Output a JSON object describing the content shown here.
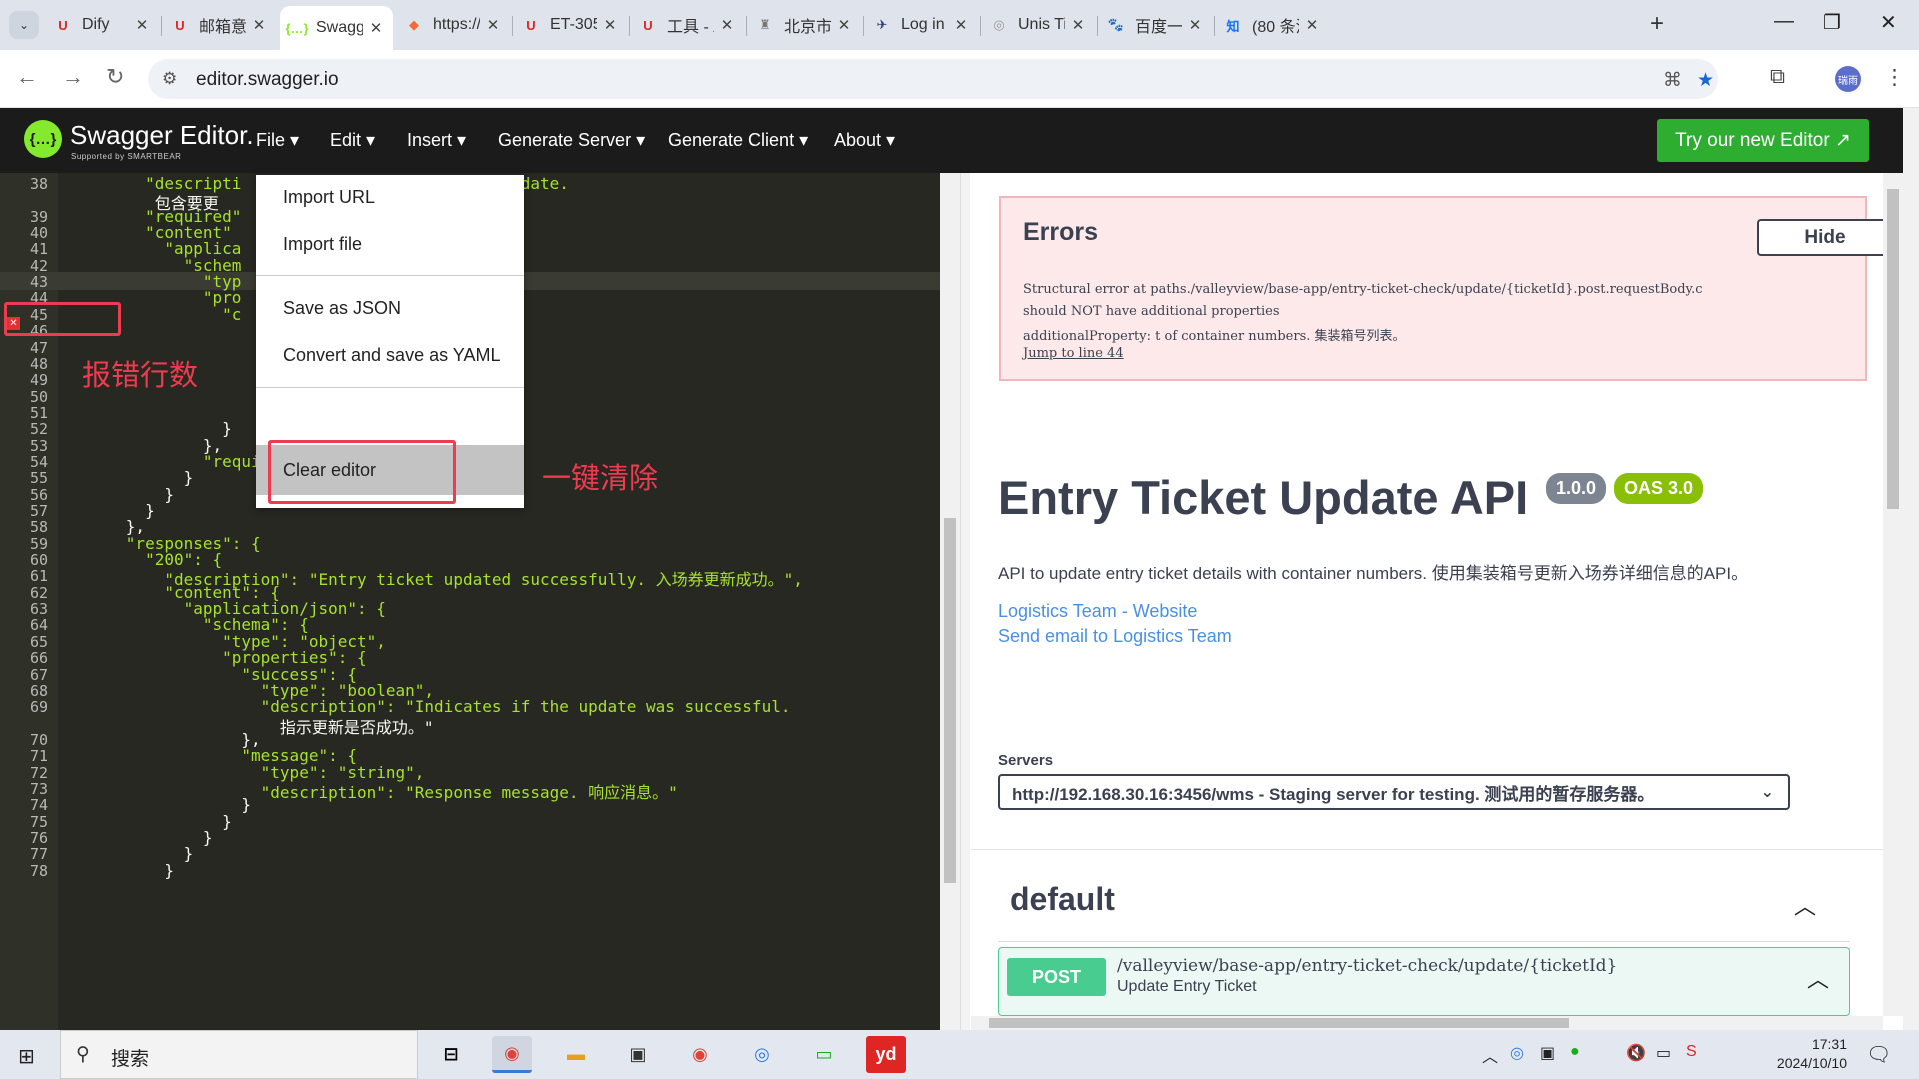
{
  "browser": {
    "tabs": [
      {
        "title": "Dify",
        "fav": "U",
        "fav_color": "#e02525"
      },
      {
        "title": "邮箱意",
        "fav": "U",
        "fav_color": "#e02525"
      },
      {
        "title": "Swagge",
        "fav": "{…}",
        "fav_color": "#85ea2d",
        "active": true
      },
      {
        "title": "https://",
        "fav": "◆",
        "fav_color": "#f46a35"
      },
      {
        "title": "ET-305",
        "fav": "U",
        "fav_color": "#e02525"
      },
      {
        "title": "工具 - A",
        "fav": "U",
        "fav_color": "#e02525"
      },
      {
        "title": "北京市",
        "fav": "♜",
        "fav_color": "#777777"
      },
      {
        "title": "Log in -",
        "fav": "✈",
        "fav_color": "#283b7e"
      },
      {
        "title": "Unis Tic",
        "fav": "◎",
        "fav_color": "#999999"
      },
      {
        "title": "百度一T",
        "fav": "🐾",
        "fav_color": "#2932e1"
      },
      {
        "title": "(80 条消",
        "fav": "知",
        "fav_color": "#1772f6"
      }
    ],
    "url": "editor.swagger.io",
    "avatar_text": "瑞雨"
  },
  "swagger_header": {
    "logo_title": "Swagger Editor.",
    "logo_sub": "Supported by SMARTBEAR",
    "menus": [
      "File ▾",
      "Edit ▾",
      "Insert ▾",
      "Generate Server ▾",
      "Generate Client ▾",
      "About ▾"
    ],
    "try_button": "Try our new Editor ↗"
  },
  "editor": {
    "lines": [
      {
        "n": "38",
        "code": "        \"descripti  \"  ...  ainer numbers to update.",
        "hl": "k"
      },
      {
        "n": "",
        "code": "         包含要更"
      },
      {
        "n": "39",
        "code": "        \"required\""
      },
      {
        "n": "40",
        "code": "        \"content\""
      },
      {
        "n": "41",
        "code": "          \"applica"
      },
      {
        "n": "42",
        "code": "            \"schem"
      },
      {
        "n": "43",
        "code": "              \"typ"
      },
      {
        "n": "44",
        "code": "              \"pro"
      },
      {
        "n": "45",
        "code": "                \"c"
      },
      {
        "n": "46",
        "code": ""
      },
      {
        "n": "47",
        "code": "                                   装箱号列表。\","
      },
      {
        "n": "48",
        "code": ""
      },
      {
        "n": "49",
        "code": ""
      },
      {
        "n": "50",
        "code": ""
      },
      {
        "n": "51",
        "code": ""
      },
      {
        "n": "52",
        "code": "                }"
      },
      {
        "n": "53",
        "code": "              },"
      },
      {
        "n": "54",
        "code": "              \"required\": [\"containerNOs\"]"
      },
      {
        "n": "55",
        "code": "            }"
      },
      {
        "n": "56",
        "code": "          }"
      },
      {
        "n": "57",
        "code": "        }"
      },
      {
        "n": "58",
        "code": "      },"
      },
      {
        "n": "59",
        "code": "      \"responses\": {"
      },
      {
        "n": "60",
        "code": "        \"200\": {"
      },
      {
        "n": "61",
        "code": "          \"description\": \"Entry ticket updated successfully. 入场券更新成功。\","
      },
      {
        "n": "62",
        "code": "          \"content\": {"
      },
      {
        "n": "63",
        "code": "            \"application/json\": {"
      },
      {
        "n": "64",
        "code": "              \"schema\": {"
      },
      {
        "n": "65",
        "code": "                \"type\": \"object\","
      },
      {
        "n": "66",
        "code": "                \"properties\": {"
      },
      {
        "n": "67",
        "code": "                  \"success\": {"
      },
      {
        "n": "68",
        "code": "                    \"type\": \"boolean\","
      },
      {
        "n": "69",
        "code": "                    \"description\": \"Indicates if the update was successful."
      },
      {
        "n": "",
        "code": "                      指示更新是否成功。\""
      },
      {
        "n": "70",
        "code": "                  },"
      },
      {
        "n": "71",
        "code": "                  \"message\": {"
      },
      {
        "n": "72",
        "code": "                    \"type\": \"string\","
      },
      {
        "n": "73",
        "code": "                    \"description\": \"Response message. 响应消息。\""
      },
      {
        "n": "74",
        "code": "                  }"
      },
      {
        "n": "75",
        "code": "                }"
      },
      {
        "n": "76",
        "code": "              }"
      },
      {
        "n": "77",
        "code": "            }"
      },
      {
        "n": "78",
        "code": "          }"
      }
    ],
    "error_line": "44"
  },
  "file_menu": {
    "items": [
      "Import URL",
      "Import file",
      "Save as JSON",
      "Convert and save as YAML",
      "Clear editor"
    ]
  },
  "annotations": {
    "error_line_label": "报错行数",
    "clear_label": "一键清除",
    "error_label": "报错"
  },
  "errors": {
    "title": "Errors",
    "hide": "Hide",
    "line1": "Structural error  at paths./valleyview/base-app/entry-ticket-check/update/{ticketId}.post.requestBody.c",
    "line2": "should NOT have additional properties",
    "line3": "additionalProperty: t of container numbers. 集装箱号列表。",
    "jump": "Jump to line 44"
  },
  "info": {
    "title": "Entry Ticket Update API",
    "version": "1.0.0",
    "oas": "OAS 3.0",
    "description": "API to update entry ticket details with container numbers. 使用集装箱号更新入场券详细信息的API。",
    "link1": "Logistics Team - Website",
    "link2": "Send email to Logistics Team"
  },
  "servers": {
    "label": "Servers",
    "selected": "http://192.168.30.16:3456/wms - Staging server for testing. 测试用的暂存服务器。"
  },
  "operations": {
    "tag": "default",
    "method": "POST",
    "path": "/valleyview/base-app/entry-ticket-check/update/{ticketId}",
    "summary": "Update Entry Ticket"
  },
  "taskbar": {
    "search": "搜索",
    "time": "17:31",
    "date": "2024/10/10"
  }
}
